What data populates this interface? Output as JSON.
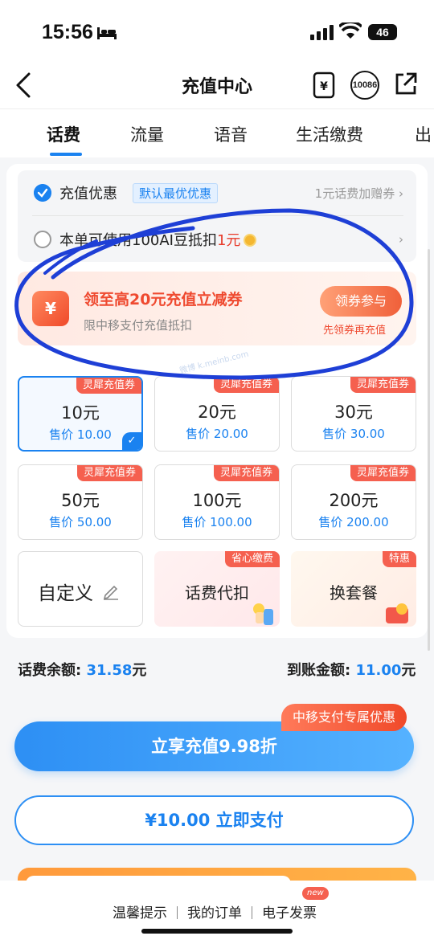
{
  "status_bar": {
    "time": "15:56",
    "battery": "46"
  },
  "nav": {
    "title": "充值中心",
    "service_number": "10086"
  },
  "tabs": [
    {
      "label": "话费"
    },
    {
      "label": "流量"
    },
    {
      "label": "语音"
    },
    {
      "label": "生活缴费"
    },
    {
      "label": "出"
    }
  ],
  "promo": {
    "row1_label": "充值优惠",
    "row1_tag": "默认最优优惠",
    "row1_right": "1元话费加赠券",
    "row2_label_prefix": "本单可使用100AI豆抵扣",
    "row2_label_amount": "1元"
  },
  "coupon": {
    "icon_symbol": "¥",
    "title": "领至高20元充值立减券",
    "subtitle": "限中移支付充值抵扣",
    "button": "领券参与",
    "button_note": "先领券再充值",
    "watermark": "微博 k.meinb.com"
  },
  "amounts": [
    {
      "tag": "灵犀充值券",
      "amount": "10元",
      "price": "售价 10.00",
      "selected": true
    },
    {
      "tag": "灵犀充值券",
      "amount": "20元",
      "price": "售价 20.00",
      "selected": false
    },
    {
      "tag": "灵犀充值券",
      "amount": "30元",
      "price": "售价 30.00",
      "selected": false
    },
    {
      "tag": "灵犀充值券",
      "amount": "50元",
      "price": "售价 50.00",
      "selected": false
    },
    {
      "tag": "灵犀充值券",
      "amount": "100元",
      "price": "售价 100.00",
      "selected": false
    },
    {
      "tag": "灵犀充值券",
      "amount": "200元",
      "price": "售价 200.00",
      "selected": false
    }
  ],
  "specials": {
    "custom_label": "自定义",
    "daikou_label": "话费代扣",
    "daikou_tag": "省心缴费",
    "taocan_label": "换套餐",
    "taocan_tag": "特惠"
  },
  "balance": {
    "left_label": "话费余额: ",
    "left_value": "31.58",
    "left_unit": "元",
    "right_label": "到账金额: ",
    "right_value": "11.00",
    "right_unit": "元"
  },
  "actions": {
    "discount_badge": "中移支付专属优惠",
    "discount_button": "立享充值9.98折",
    "pay_button": "¥10.00  立即支付"
  },
  "footer": {
    "link1": "温馨提示",
    "link2": "我的订单",
    "link3": "电子发票",
    "new_badge": "new"
  },
  "colors": {
    "accent": "#1a82f0",
    "promo_red": "#ef4a30",
    "annotation_ink": "#1e3fd6"
  }
}
